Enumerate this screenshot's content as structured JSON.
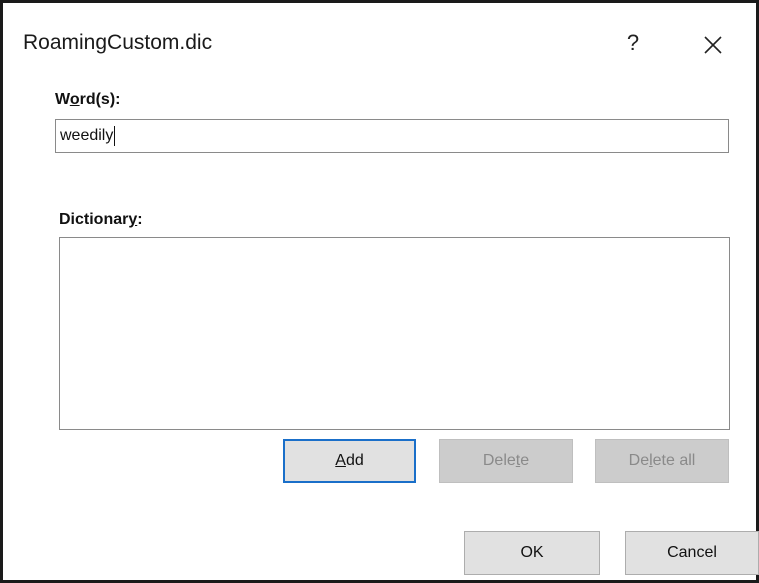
{
  "dialog": {
    "title": "RoamingCustom.dic",
    "help_glyph": "?",
    "close_glyph": "×"
  },
  "words": {
    "label_pre": "W",
    "label_accel": "o",
    "label_post": "rd(s):",
    "value": "weedily"
  },
  "dictionary": {
    "label_pre": "Dictionar",
    "label_accel": "y",
    "label_post": ":",
    "entries": []
  },
  "buttons": {
    "add": {
      "pre": "",
      "accel": "A",
      "post": "dd"
    },
    "delete": {
      "pre": "Dele",
      "accel": "t",
      "post": "e"
    },
    "delete_all": {
      "pre": "De",
      "accel": "l",
      "post": "ete all"
    },
    "ok": "OK",
    "cancel": "Cancel"
  },
  "icons": {
    "help": "help-icon",
    "close": "close-icon"
  }
}
